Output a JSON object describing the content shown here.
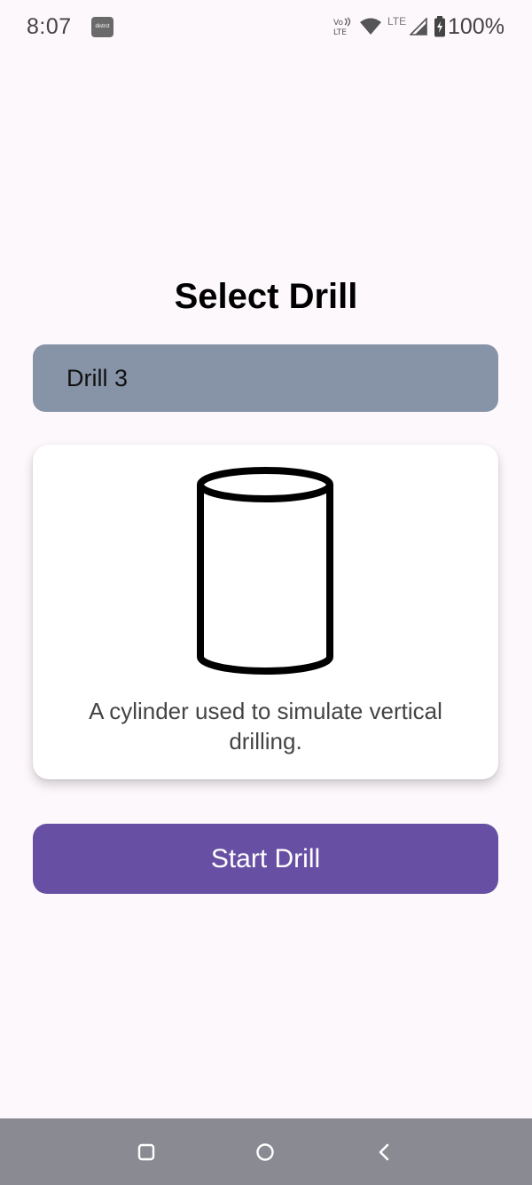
{
  "status_bar": {
    "time": "8:07",
    "app_icon_text": "distrct",
    "network_type": "LTE",
    "battery_percent": "100%",
    "icons": [
      "app-notification-icon",
      "volte-icon",
      "wifi-icon",
      "signal-icon",
      "battery-charging-icon"
    ]
  },
  "main": {
    "title": "Select Drill",
    "selected_drill": "Drill 3",
    "drill_icon": "cylinder-icon",
    "drill_description": "A cylinder used to simulate vertical drilling.",
    "start_button_label": "Start Drill"
  },
  "nav_bar": {
    "icons": [
      "recents-icon",
      "home-icon",
      "back-icon"
    ]
  },
  "colors": {
    "background": "#fdf8fc",
    "select_field": "#8794a7",
    "card": "#ffffff",
    "primary_button": "#6750a4",
    "nav_bar": "#8a8b92"
  }
}
